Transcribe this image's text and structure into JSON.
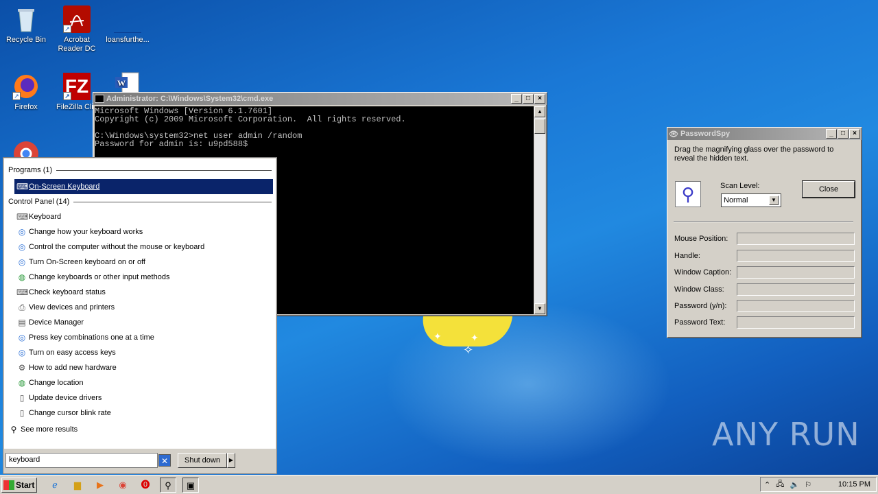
{
  "desktop": {
    "icons": [
      {
        "label": "Recycle Bin",
        "icon": "recycle-bin-icon"
      },
      {
        "label": "Acrobat Reader DC",
        "icon": "acrobat-icon"
      },
      {
        "label": "loansfurthe...",
        "icon": "file-icon"
      },
      {
        "label": "Firefox",
        "icon": "firefox-icon"
      },
      {
        "label": "FileZilla Clie",
        "icon": "filezilla-icon"
      },
      {
        "label": "",
        "icon": "word-doc-icon"
      },
      {
        "label": "",
        "icon": "chrome-icon"
      }
    ],
    "watermark": "ANY RUN"
  },
  "cmd": {
    "title": "Administrator: C:\\Windows\\System32\\cmd.exe",
    "lines": [
      "Microsoft Windows [Version 6.1.7601]",
      "Copyright (c) 2009 Microsoft Corporation.  All rights reserved.",
      "",
      "C:\\Windows\\system32>net user admin /random",
      "Password for admin is: u9pd588$"
    ]
  },
  "startmenu": {
    "programs_header": "Programs (1)",
    "programs": [
      {
        "label": "On-Screen Keyboard",
        "icon": "keyboard-icon"
      }
    ],
    "cp_header": "Control Panel (14)",
    "control_panel": [
      {
        "label": "Keyboard",
        "icon": "keyboard-icon"
      },
      {
        "label": "Change how your keyboard works",
        "icon": "ease-of-access-icon"
      },
      {
        "label": "Control the computer without the mouse or keyboard",
        "icon": "ease-of-access-icon"
      },
      {
        "label": "Turn On-Screen keyboard on or off",
        "icon": "ease-of-access-icon"
      },
      {
        "label": "Change keyboards or other input methods",
        "icon": "globe-icon"
      },
      {
        "label": "Check keyboard status",
        "icon": "keyboard-icon"
      },
      {
        "label": "View devices and printers",
        "icon": "printer-icon"
      },
      {
        "label": "Device Manager",
        "icon": "device-manager-icon"
      },
      {
        "label": "Press key combinations one at a time",
        "icon": "ease-of-access-icon"
      },
      {
        "label": "Turn on easy access keys",
        "icon": "ease-of-access-icon"
      },
      {
        "label": "How to add new hardware",
        "icon": "hardware-icon"
      },
      {
        "label": "Change location",
        "icon": "globe-icon"
      },
      {
        "label": "Update device drivers",
        "icon": "page-icon"
      },
      {
        "label": "Change cursor blink rate",
        "icon": "page-icon"
      }
    ],
    "see_more": "See more results",
    "search_value": "keyboard",
    "shutdown_label": "Shut down"
  },
  "passwordspy": {
    "title": "PasswordSpy",
    "instructions": "Drag the magnifying glass over the password to reveal the hidden text.",
    "scan_label": "Scan Level:",
    "scan_value": "Normal",
    "close_label": "Close",
    "fields": [
      {
        "label": "Mouse Position:",
        "value": ""
      },
      {
        "label": "Handle:",
        "value": ""
      },
      {
        "label": "Window Caption:",
        "value": ""
      },
      {
        "label": "Window Class:",
        "value": ""
      },
      {
        "label": "Password (y/n):",
        "value": ""
      },
      {
        "label": "Password Text:",
        "value": ""
      }
    ]
  },
  "taskbar": {
    "start_label": "Start",
    "clock": "10:15 PM"
  }
}
